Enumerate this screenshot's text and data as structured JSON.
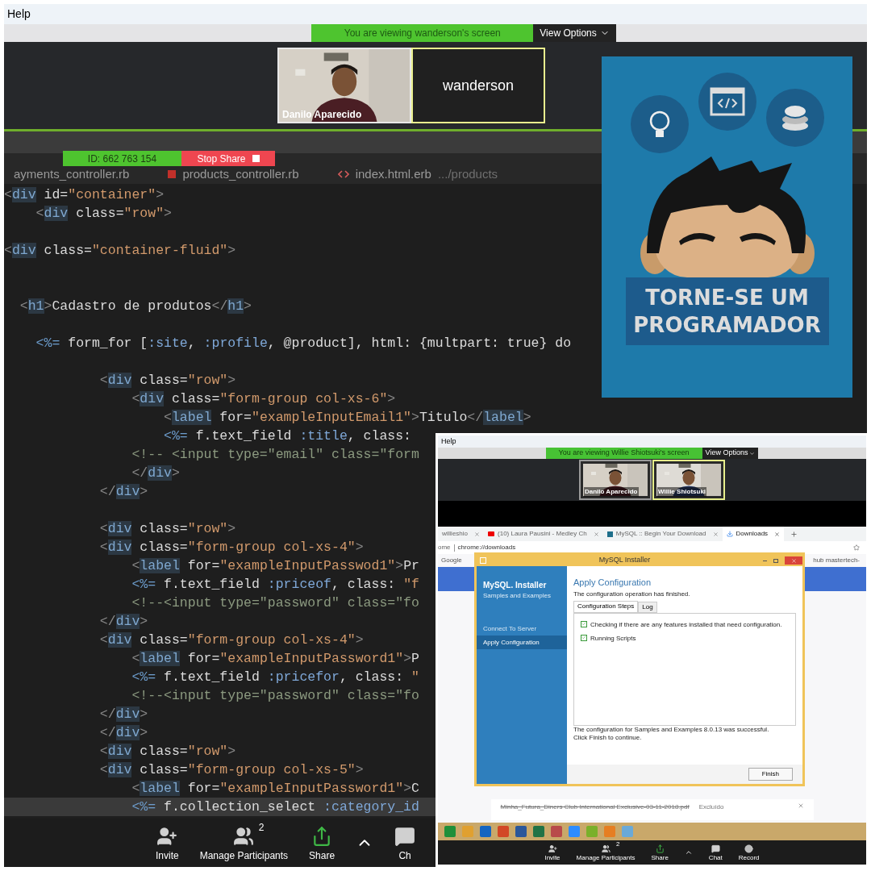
{
  "menu_bar": {
    "items": [
      "Help"
    ]
  },
  "share_banner": {
    "text": "You are viewing wanderson's screen",
    "view_options": "View Options"
  },
  "videos": [
    {
      "kind": "camera",
      "name": "Danilo Aparecido",
      "active": false
    },
    {
      "kind": "name",
      "name": "wanderson",
      "active": true
    }
  ],
  "meeting_controls": {
    "meeting_id": "ID: 662 763 154",
    "stop_share": "Stop Share"
  },
  "editor": {
    "tabs": [
      {
        "kind": "plain",
        "label": "ayments_controller.rb"
      },
      {
        "kind": "ruby",
        "label": "products_controller.rb"
      },
      {
        "kind": "html",
        "label": "index.html.erb",
        "detail": ".../products"
      }
    ],
    "lines": [
      {
        "kind": "code",
        "text": "<div id=\"container\">"
      },
      {
        "kind": "code",
        "text": "    <div class=\"row\">"
      },
      {
        "kind": "blank"
      },
      {
        "kind": "code",
        "text": "<div class=\"container-fluid\">"
      },
      {
        "kind": "blank"
      },
      {
        "kind": "blank"
      },
      {
        "kind": "code",
        "text": "  <h1>Cadastro de produtos</h1>"
      },
      {
        "kind": "blank"
      },
      {
        "kind": "code",
        "text": "    <%= form_for [:site, :profile, @product], html: {multpart: true} do"
      },
      {
        "kind": "blank"
      },
      {
        "kind": "code",
        "text": "            <div class=\"row\">"
      },
      {
        "kind": "code",
        "text": "                <div class=\"form-group col-xs-6\">"
      },
      {
        "kind": "code",
        "text": "                    <label for=\"exampleInputEmail1\">Titulo</label>"
      },
      {
        "kind": "code",
        "text": "                    <%= f.text_field :title, class:"
      },
      {
        "kind": "comment",
        "text": "                <!-- <input type=\"email\" class=\"form"
      },
      {
        "kind": "code",
        "text": "                </div>"
      },
      {
        "kind": "code",
        "text": "            </div>"
      },
      {
        "kind": "blank"
      },
      {
        "kind": "code",
        "text": "            <div class=\"row\">"
      },
      {
        "kind": "code",
        "text": "            <div class=\"form-group col-xs-4\">"
      },
      {
        "kind": "code",
        "text": "                <label for=\"exampleInputPasswod1\">Pr"
      },
      {
        "kind": "code",
        "text": "                <%= f.text_field :priceof, class: \"f"
      },
      {
        "kind": "comment",
        "text": "                <!--<input type=\"password\" class=\"fo"
      },
      {
        "kind": "code",
        "text": "            </div>"
      },
      {
        "kind": "code",
        "text": "            <div class=\"form-group col-xs-4\">"
      },
      {
        "kind": "code",
        "text": "                <label for=\"exampleInputPassword1\">P"
      },
      {
        "kind": "code",
        "text": "                <%= f.text_field :pricefor, class: \""
      },
      {
        "kind": "comment",
        "text": "                <!--<input type=\"password\" class=\"fo"
      },
      {
        "kind": "code",
        "text": "            </div>"
      },
      {
        "kind": "code",
        "text": "            </div>"
      },
      {
        "kind": "code",
        "text": "            <div class=\"row\">"
      },
      {
        "kind": "code",
        "text": "            <div class=\"form-group col-xs-5\">"
      },
      {
        "kind": "code",
        "text": "                <label for=\"exampleInputPassword1\">C"
      },
      {
        "kind": "current",
        "text": "                <%= f.collection_select :category_id"
      }
    ]
  },
  "promo": {
    "headline": [
      "TORNE-SE UM",
      "PROGRAMADOR"
    ]
  },
  "toolbar": {
    "items": [
      {
        "kind": "invite",
        "label": "Invite"
      },
      {
        "kind": "participants",
        "label": "Manage Participants",
        "count": "2"
      },
      {
        "kind": "share",
        "label": "Share"
      },
      {
        "kind": "caret"
      },
      {
        "kind": "chat",
        "label": "Ch"
      }
    ]
  },
  "inset": {
    "menu_bar": {
      "items": [
        "Help"
      ]
    },
    "share_banner": {
      "text": "You are viewing Willie Shiotsuki's screen",
      "view_options": "View Options"
    },
    "videos": [
      {
        "name": "Danilo Aparecido",
        "active": false
      },
      {
        "name": "Willie Shiotsuki",
        "active": true
      }
    ],
    "browser": {
      "tabs": [
        {
          "kind": "page",
          "label": "willieshio",
          "selected": false
        },
        {
          "kind": "video",
          "label": "(10) Laura Pausini - Medley Ch",
          "selected": false
        },
        {
          "kind": "site",
          "label": "MySQL :: Begin Your Download",
          "selected": false
        },
        {
          "kind": "download",
          "label": "Downloads",
          "selected": true
        }
      ],
      "address": {
        "prefix": "ome",
        "url": "chrome://downloads"
      },
      "bookmarks": [
        "Google"
      ],
      "bookmark_right": "hub mastertech-",
      "download": {
        "file": "Minha_Futura_Diners Club International Exclusive-03-11-2018.pdf",
        "status": "Excluído"
      }
    },
    "installer": {
      "title": "MySQL Installer",
      "brand": "MySQL. Installer",
      "subtitle": "Samples and Examples",
      "steps": [
        {
          "label": "Connect To Server",
          "selected": false
        },
        {
          "label": "Apply Configuration",
          "selected": true
        }
      ],
      "heading": "Apply Configuration",
      "message": "The configuration operation has finished.",
      "tabs": [
        {
          "label": "Configuration Steps",
          "selected": true
        },
        {
          "label": "Log",
          "selected": false
        }
      ],
      "checks": [
        {
          "label": "Checking if there are any features installed that need configuration.",
          "checked": true
        },
        {
          "label": "Running Scripts",
          "checked": true
        }
      ],
      "result": [
        "The configuration for Samples and Examples 8.0.13 was successful.",
        "Click Finish to continue."
      ],
      "finish": "Finish"
    },
    "toolbar": {
      "items": [
        {
          "kind": "invite",
          "label": "Invite"
        },
        {
          "kind": "participants",
          "label": "Manage Participants",
          "count": "2"
        },
        {
          "kind": "share",
          "label": "Share"
        },
        {
          "kind": "caret"
        },
        {
          "kind": "chat",
          "label": "Chat"
        },
        {
          "kind": "record",
          "label": "Record"
        }
      ]
    }
  }
}
